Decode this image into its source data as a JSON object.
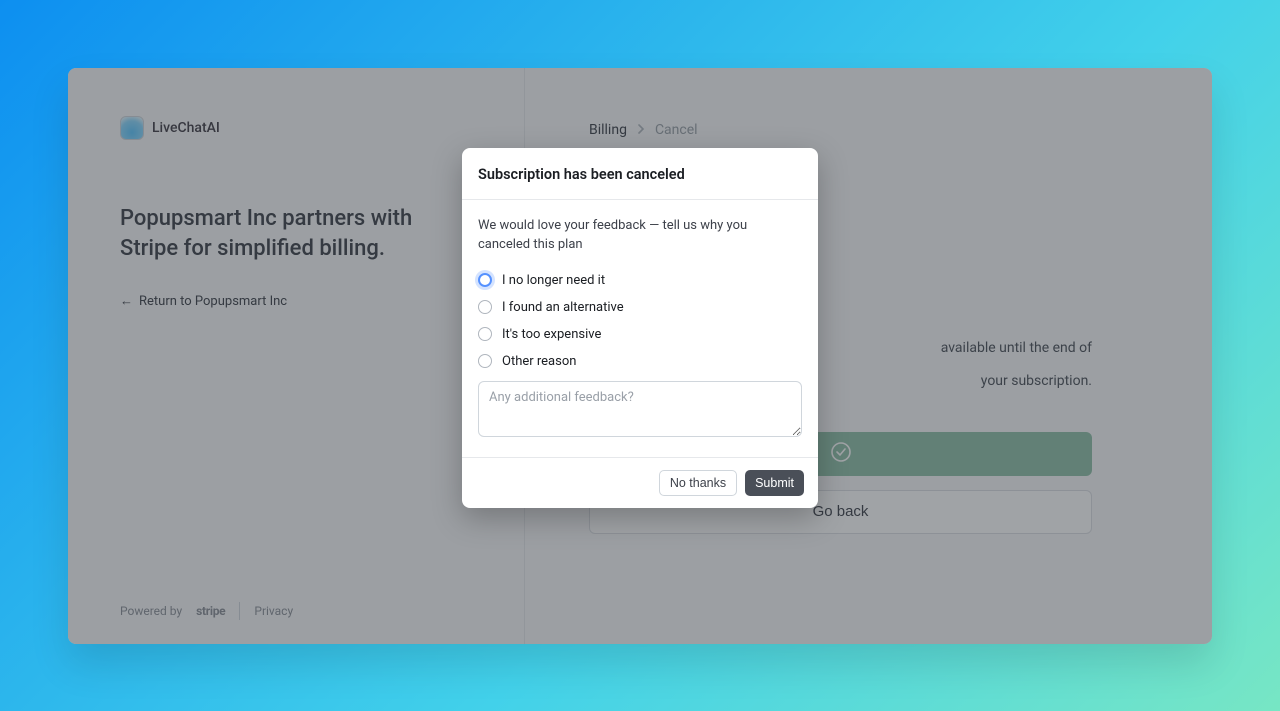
{
  "brand": {
    "name": "LiveChatAI"
  },
  "left": {
    "headline": "Popupsmart Inc partners with Stripe for simplified billing.",
    "return": "Return to Popupsmart Inc"
  },
  "footer": {
    "powered": "Powered by",
    "stripe": "stripe",
    "privacy": "Privacy"
  },
  "crumbs": {
    "root": "Billing",
    "leaf": "Cancel"
  },
  "bg": {
    "line1": "available until the end of",
    "line2": "your subscription.",
    "goback": "Go back"
  },
  "modal": {
    "title": "Subscription has been canceled",
    "desc": "We would love your feedback — tell us why you canceled this plan",
    "options": [
      "I no longer need it",
      "I found an alternative",
      "It's too expensive",
      "Other reason"
    ],
    "placeholder": "Any additional feedback?",
    "no_thanks": "No thanks",
    "submit": "Submit"
  }
}
